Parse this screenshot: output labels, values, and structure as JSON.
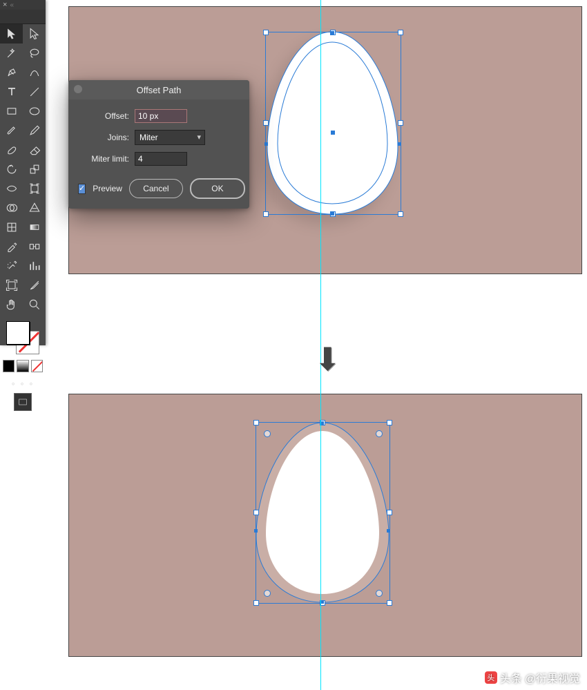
{
  "dialog": {
    "title": "Offset Path",
    "offset_label": "Offset:",
    "offset_value": "10 px",
    "joins_label": "Joins:",
    "joins_value": "Miter",
    "miter_label": "Miter limit:",
    "miter_value": "4",
    "preview_label": "Preview",
    "preview_checked": true,
    "cancel_label": "Cancel",
    "ok_label": "OK"
  },
  "tools": {
    "list": [
      "selection",
      "direct-selection",
      "magic-wand",
      "lasso",
      "pen",
      "curvature",
      "type",
      "line",
      "rectangle",
      "ellipse",
      "paintbrush",
      "pencil",
      "eraser",
      "blob-brush",
      "rotate",
      "scale",
      "reflect",
      "free-transform",
      "width",
      "shape-builder",
      "perspective",
      "mesh",
      "gradient",
      "eyedropper",
      "blend",
      "symbol-sprayer",
      "column-graph",
      "artboard",
      "slice",
      "hand",
      "zoom"
    ],
    "selected": 0
  },
  "colors": {
    "fill": "#ffffff",
    "stroke": "none",
    "guide": "#00e5ff",
    "artboard": "#bb9d96",
    "selection": "#2a7bd6"
  },
  "watermark": {
    "prefix": "头条",
    "handle": "@衍果视觉"
  }
}
